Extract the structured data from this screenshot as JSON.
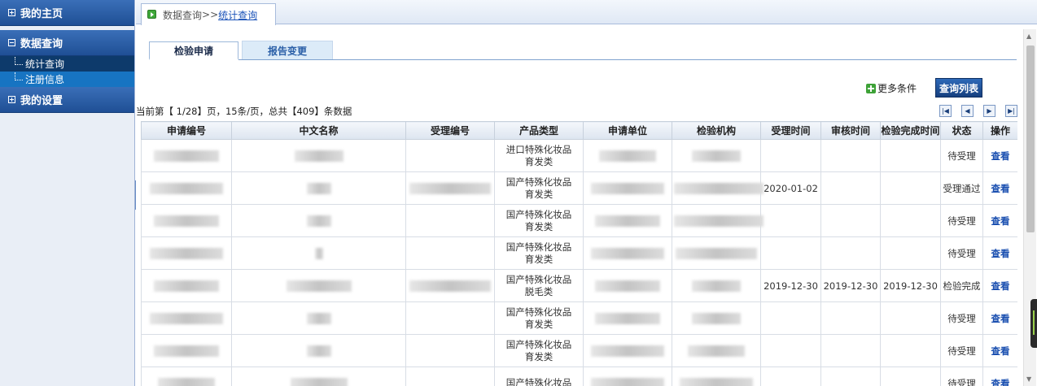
{
  "sidebar": {
    "home": "我的主页",
    "data_query": "数据查询",
    "sub_stats": "统计查询",
    "sub_register": "注册信息",
    "settings": "我的设置"
  },
  "breadcrumb": {
    "parent": "数据查询",
    "separator": ">>",
    "current": "统计查询"
  },
  "tabs": {
    "active": "检验申请",
    "inactive": "报告变更"
  },
  "toolbar": {
    "more_label": "更多条件",
    "query_label": "查询列表"
  },
  "summary": "当前第【 1/28】页，15条/页，总共【409】条数据",
  "pager": {
    "first": "first-page-icon",
    "prev": "prev-page-icon",
    "next": "next-page-icon",
    "last": "last-page-icon"
  },
  "table": {
    "headers": [
      "申请编号",
      "中文名称",
      "受理编号",
      "产品类型",
      "申请单位",
      "检验机构",
      "受理时间",
      "审核时间",
      "检验完成时间",
      "状态",
      "操作"
    ],
    "rows": [
      {
        "ptype1": "进口特殊化妆品",
        "ptype2": "育发类",
        "accept": "",
        "review": "",
        "done": "",
        "status": "待受理",
        "op": "查看"
      },
      {
        "ptype1": "国产特殊化妆品",
        "ptype2": "育发类",
        "accept": "2020-01-02",
        "review": "",
        "done": "",
        "status": "受理通过",
        "op": "查看"
      },
      {
        "ptype1": "国产特殊化妆品",
        "ptype2": "育发类",
        "accept": "",
        "review": "",
        "done": "",
        "status": "待受理",
        "op": "查看"
      },
      {
        "ptype1": "国产特殊化妆品",
        "ptype2": "育发类",
        "accept": "",
        "review": "",
        "done": "",
        "status": "待受理",
        "op": "查看"
      },
      {
        "ptype1": "国产特殊化妆品",
        "ptype2": "脱毛类",
        "accept": "2019-12-30",
        "review": "2019-12-30",
        "done": "2019-12-30",
        "status": "检验完成",
        "op": "查看"
      },
      {
        "ptype1": "国产特殊化妆品",
        "ptype2": "育发类",
        "accept": "",
        "review": "",
        "done": "",
        "status": "待受理",
        "op": "查看"
      },
      {
        "ptype1": "国产特殊化妆品",
        "ptype2": "育发类",
        "accept": "",
        "review": "",
        "done": "",
        "status": "待受理",
        "op": "查看"
      },
      {
        "ptype1": "国产特殊化妆品",
        "ptype2": "",
        "accept": "",
        "review": "",
        "done": "",
        "status": "待受理",
        "op": "查看"
      }
    ]
  }
}
